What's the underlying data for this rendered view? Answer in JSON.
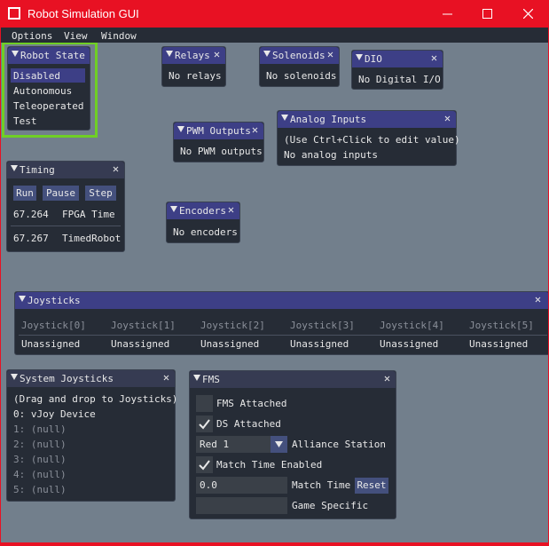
{
  "window": {
    "title": "Robot Simulation GUI"
  },
  "menu": [
    "Options",
    "View",
    "Window"
  ],
  "robot_state": {
    "title": "Robot State",
    "items": [
      "Disabled",
      "Autonomous",
      "Teleoperated",
      "Test"
    ],
    "selected": "Disabled",
    "highlight_color": "#6fcf25"
  },
  "relays": {
    "title": "Relays",
    "text": "No relays"
  },
  "solenoids": {
    "title": "Solenoids",
    "text": "No solenoids"
  },
  "dio": {
    "title": "DIO",
    "text": "No Digital I/O"
  },
  "pwm": {
    "title": "PWM Outputs",
    "text": "No PWM outputs"
  },
  "analog": {
    "title": "Analog Inputs",
    "hint": "(Use Ctrl+Click to edit value)",
    "text": "No analog inputs"
  },
  "timing": {
    "title": "Timing",
    "buttons": [
      "Run",
      "Pause",
      "Step"
    ],
    "rows": [
      {
        "value": "67.264",
        "label": "FPGA Time"
      },
      {
        "value": "67.267",
        "label": "TimedRobot"
      }
    ]
  },
  "encoders": {
    "title": "Encoders",
    "text": "No encoders"
  },
  "joysticks": {
    "title": "Joysticks",
    "columns": [
      {
        "name": "Joystick[0]",
        "value": "Unassigned"
      },
      {
        "name": "Joystick[1]",
        "value": "Unassigned"
      },
      {
        "name": "Joystick[2]",
        "value": "Unassigned"
      },
      {
        "name": "Joystick[3]",
        "value": "Unassigned"
      },
      {
        "name": "Joystick[4]",
        "value": "Unassigned"
      },
      {
        "name": "Joystick[5]",
        "value": "Unassigned"
      }
    ]
  },
  "system_joysticks": {
    "title": "System Joysticks",
    "hint": "(Drag and drop to Joysticks)",
    "devices": [
      "0: vJoy Device",
      "1: (null)",
      "2: (null)",
      "3: (null)",
      "4: (null)",
      "5: (null)"
    ]
  },
  "fms": {
    "title": "FMS",
    "fms_attached": {
      "label": "FMS Attached",
      "checked": false
    },
    "ds_attached": {
      "label": "DS Attached",
      "checked": true
    },
    "alliance": {
      "value": "Red 1",
      "label": "Alliance Station"
    },
    "match_time_enabled": {
      "label": "Match Time Enabled",
      "checked": true
    },
    "match_time": {
      "value": "0.0",
      "label": "Match Time",
      "reset": "Reset"
    },
    "game_specific": {
      "value": "",
      "label": "Game Specific"
    }
  }
}
